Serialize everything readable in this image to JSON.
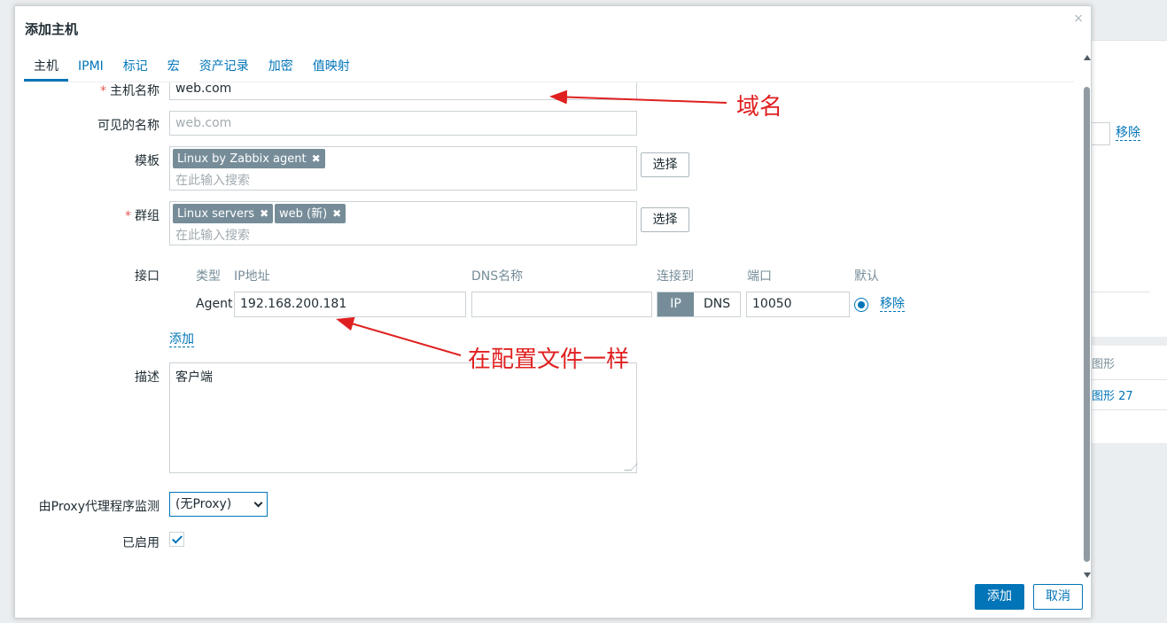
{
  "background": {
    "remove_link": "移除",
    "table_head_fragment": "图形",
    "table_cell_fragment": "图形 27"
  },
  "dialog": {
    "title": "添加主机",
    "close": "×",
    "tabs": [
      "主机",
      "IPMI",
      "标记",
      "宏",
      "资产记录",
      "加密",
      "值映射"
    ]
  },
  "form": {
    "host_name": {
      "label": "主机名称",
      "value": "web.com"
    },
    "visible_name": {
      "label": "可见的名称",
      "placeholder": "web.com"
    },
    "templates": {
      "label": "模板",
      "tags": [
        "Linux by Zabbix agent"
      ],
      "placeholder": "在此输入搜索",
      "button": "选择"
    },
    "groups": {
      "label": "群组",
      "tags": [
        "Linux servers",
        "web (新)"
      ],
      "placeholder": "在此输入搜索",
      "button": "选择"
    },
    "interfaces": {
      "label": "接口",
      "headers": {
        "type": "类型",
        "ip": "IP地址",
        "dns": "DNS名称",
        "connect": "连接到",
        "port": "端口",
        "default": "默认"
      },
      "row": {
        "type": "Agent",
        "ip": "192.168.200.181",
        "dns": "",
        "connect_options": [
          "IP",
          "DNS"
        ],
        "connect_selected": "IP",
        "port": "10050",
        "remove": "移除"
      },
      "add": "添加"
    },
    "description": {
      "label": "描述",
      "value": "客户端"
    },
    "proxy": {
      "label": "由Proxy代理程序监测",
      "value": "(无Proxy)"
    },
    "enabled": {
      "label": "已启用",
      "checked": true
    }
  },
  "footer": {
    "add": "添加",
    "cancel": "取消"
  },
  "annotations": {
    "domain": "域名",
    "config": "在配置文件一样"
  },
  "colors": {
    "accent": "#0275b8",
    "tag": "#768d99",
    "annotation": "#e02020"
  }
}
